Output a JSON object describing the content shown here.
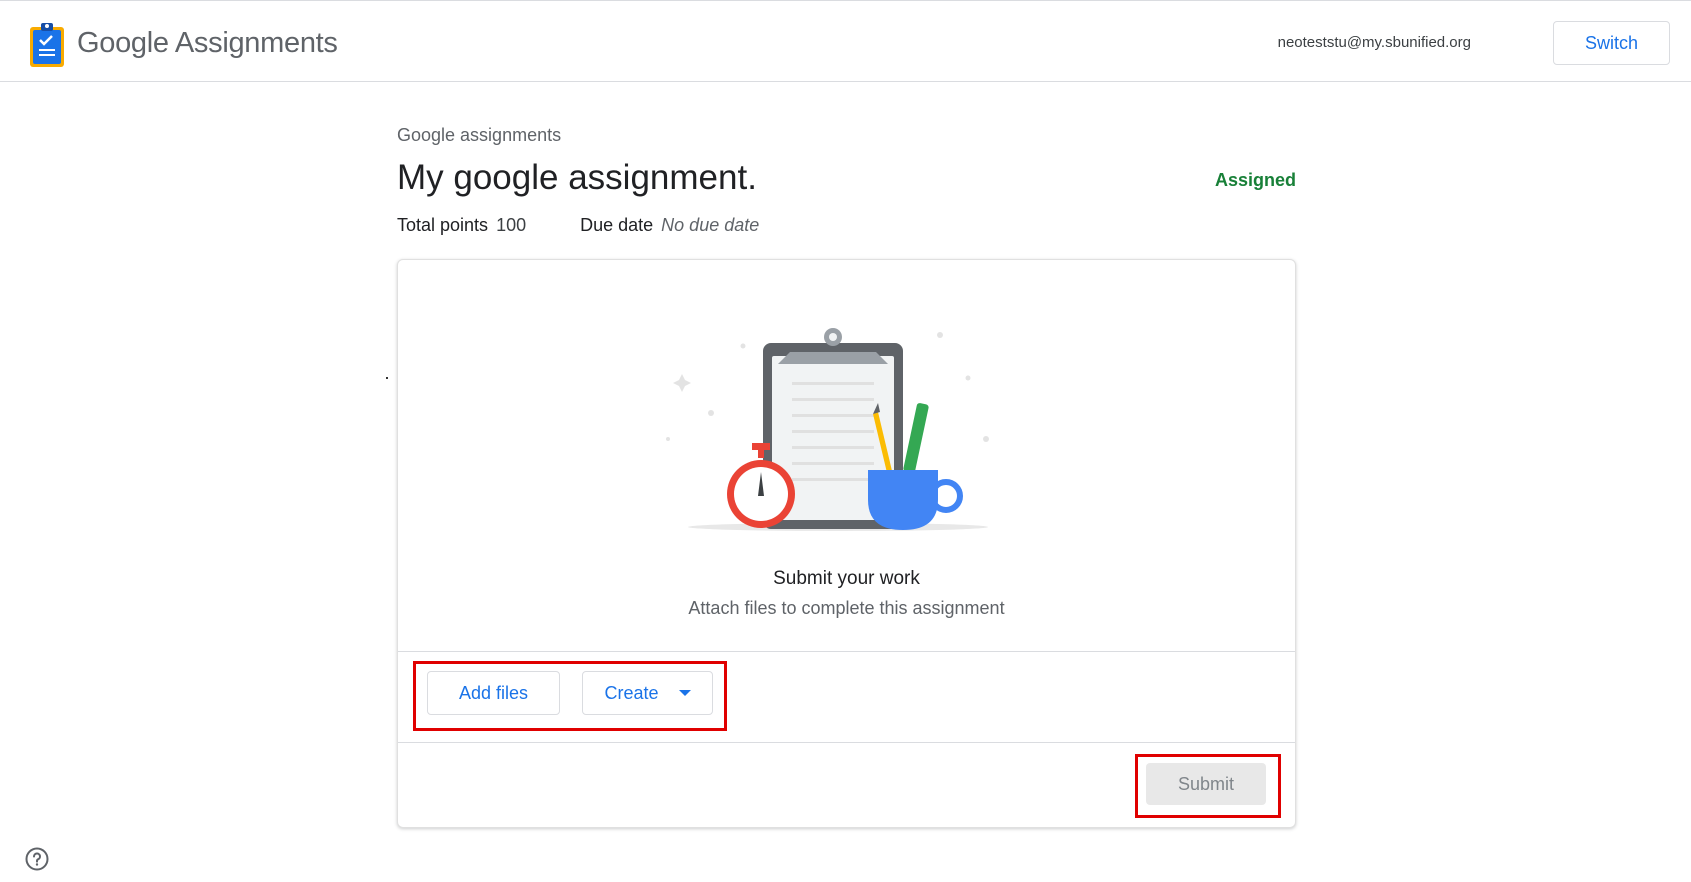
{
  "header": {
    "brand_google": "Google",
    "brand_product": "Assignments",
    "account_email": "neoteststu@my.sbunified.org",
    "switch_label": "Switch"
  },
  "assignment": {
    "breadcrumb": "Google assignments",
    "title": "My google assignment.",
    "status": "Assigned",
    "total_points_label": "Total points",
    "total_points_value": "100",
    "due_date_label": "Due date",
    "due_date_value": "No due date"
  },
  "card": {
    "heading": "Submit your work",
    "subheading": "Attach files to complete this assignment",
    "add_files_label": "Add files",
    "create_label": "Create",
    "submit_label": "Submit"
  },
  "colors": {
    "accent": "#1a73e8",
    "status": "#188038",
    "highlight": "#e00000"
  },
  "icons": [
    "assignments-logo-icon",
    "dropdown-caret-icon",
    "help-icon"
  ]
}
